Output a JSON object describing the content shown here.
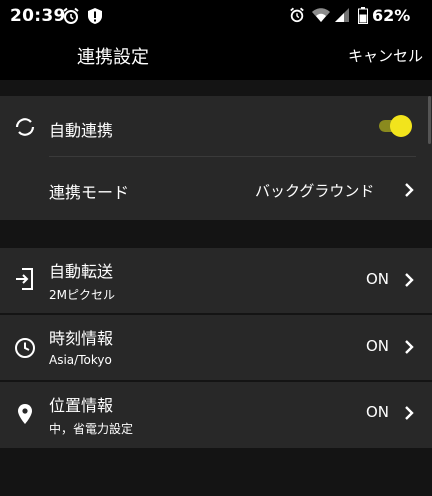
{
  "status_bar": {
    "time": "20:39",
    "battery": "62%",
    "icons_left": [
      "alarm-icon",
      "alert-shield-icon"
    ],
    "icons_right": [
      "alarm-icon",
      "wifi-icon",
      "signal-icon",
      "battery-icon"
    ]
  },
  "header": {
    "title": "連携設定",
    "cancel_label": "キャンセル"
  },
  "sync_section": {
    "auto_sync_label": "自動連携",
    "auto_sync_enabled": true,
    "mode_label": "連携モード",
    "mode_value": "バックグラウンド"
  },
  "settings": [
    {
      "label": "自動転送",
      "sublabel": "2Mピクセル",
      "value": "ON",
      "icon": "transfer-icon"
    },
    {
      "label": "時刻情報",
      "sublabel": "Asia/Tokyo",
      "value": "ON",
      "icon": "clock-icon"
    },
    {
      "label": "位置情報",
      "sublabel": "中，省電力設定",
      "value": "ON",
      "icon": "location-pin-icon"
    }
  ],
  "colors": {
    "background": "#000000",
    "panel": "#282828",
    "toggle_thumb": "#f2e41c",
    "toggle_track": "#8a8a1e"
  }
}
